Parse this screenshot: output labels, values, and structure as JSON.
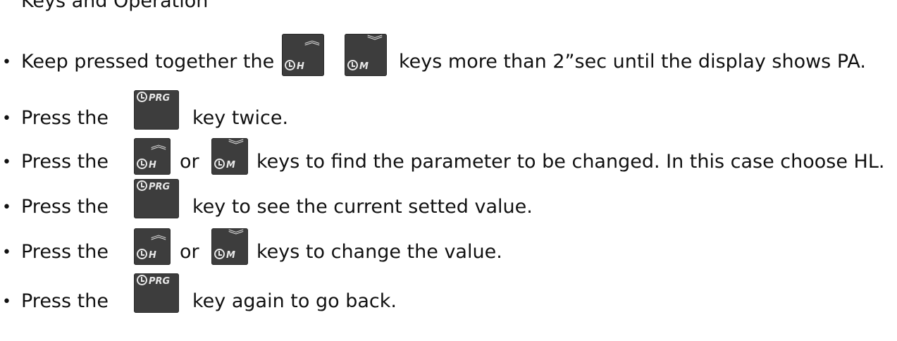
{
  "top_fragment": "Keys and Operation",
  "bullet": "•",
  "keys": {
    "h": {
      "label": "H",
      "arrow": "up"
    },
    "m": {
      "label": "M",
      "arrow": "down"
    },
    "prg": {
      "label": "PRG"
    }
  },
  "steps": [
    {
      "pre": "Keep pressed together the",
      "post": "keys more than 2”sec until the display shows PA."
    },
    {
      "pre": "Press the",
      "post": "key twice."
    },
    {
      "pre": "Press the",
      "mid": "or",
      "post": "keys to find the parameter to be changed. In this case choose HL."
    },
    {
      "pre": "Press the",
      "post": "key to see the current setted value."
    },
    {
      "pre": "Press the",
      "mid": "or",
      "post": "keys to change the value."
    },
    {
      "pre": "Press the",
      "post": "key again to go back."
    }
  ]
}
